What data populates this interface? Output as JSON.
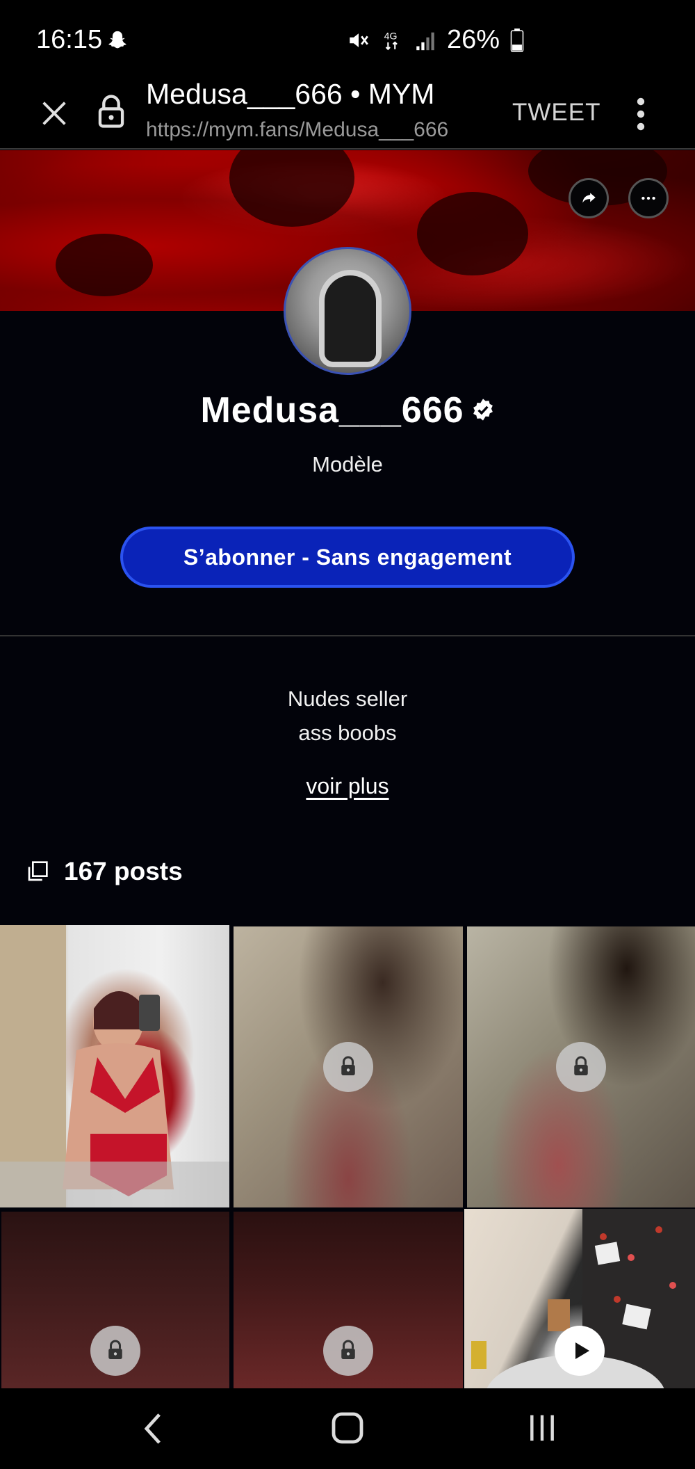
{
  "status_bar": {
    "time": "16:15",
    "network": "4G",
    "battery": "26%"
  },
  "browser": {
    "title": "Medusa___666 • MYM",
    "url": "https://mym.fans/Medusa___666",
    "tweet_label": "TWEET"
  },
  "profile": {
    "name": "Medusa___666",
    "role": "Modèle",
    "subscribe_label": "S’abonner - Sans engagement",
    "bio_line1": "Nudes seller",
    "bio_line2": "ass boobs",
    "see_more": "voir plus",
    "posts_count": "167 posts"
  },
  "colors": {
    "accent": "#0a23b8",
    "accent_border": "#2b53f0",
    "background": "#02030a"
  },
  "grid": {
    "tiles": [
      {
        "state": "visible-photo"
      },
      {
        "state": "locked",
        "icon": "lock-icon"
      },
      {
        "state": "locked",
        "icon": "lock-icon"
      },
      {
        "state": "locked",
        "icon": "lock-icon"
      },
      {
        "state": "locked",
        "icon": "lock-icon"
      },
      {
        "state": "video",
        "icon": "play-icon"
      }
    ]
  }
}
